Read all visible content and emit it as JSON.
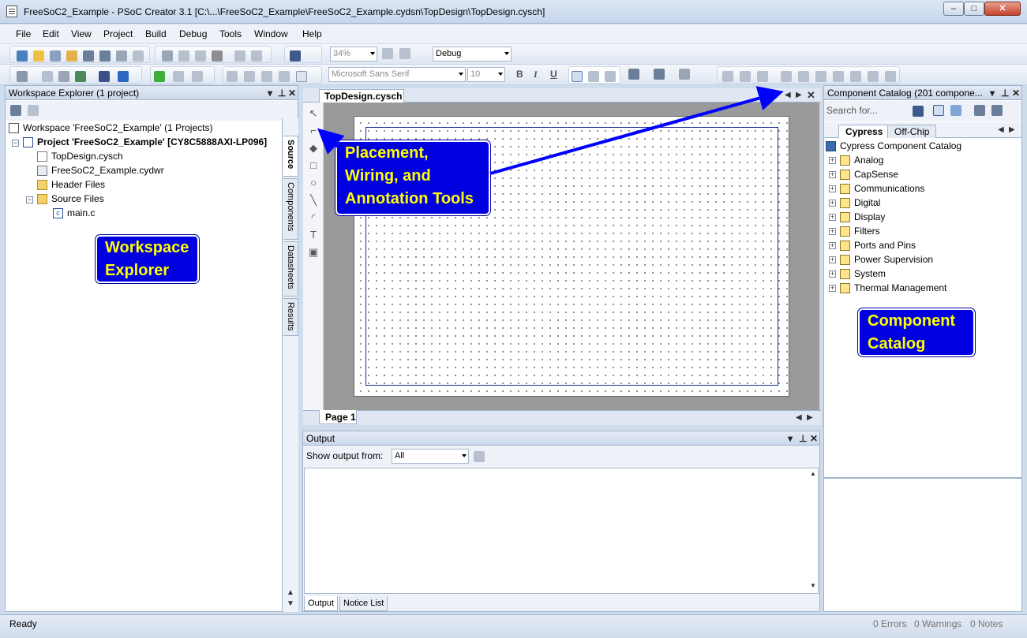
{
  "window": {
    "title": "FreeSoC2_Example - PSoC Creator 3.1  [C:\\...\\FreeSoC2_Example\\FreeSoC2_Example.cydsn\\TopDesign\\TopDesign.cysch]",
    "min": "–",
    "max": "□",
    "close": "✕"
  },
  "menu": [
    "File",
    "Edit",
    "View",
    "Project",
    "Build",
    "Debug",
    "Tools",
    "Window",
    "Help"
  ],
  "toolbar": {
    "zoom": "34%",
    "config": "Debug",
    "font": "Microsoft Sans Serif",
    "font_size": "10",
    "bold": "B",
    "italic": "I",
    "underline": "U"
  },
  "workspace": {
    "header": "Workspace Explorer (1 project)",
    "tree": [
      {
        "label": "Workspace 'FreeSoC2_Example' (1 Projects)",
        "icon": "workspace-icon"
      },
      {
        "label": "Project  'FreeSoC2_Example' [CY8C5888AXI-LP096]",
        "icon": "project-icon"
      },
      {
        "label": "TopDesign.cysch",
        "icon": "schematic-icon"
      },
      {
        "label": "FreeSoC2_Example.cydwr",
        "icon": "cydwr-icon"
      },
      {
        "label": "Header Files",
        "icon": "folder-icon"
      },
      {
        "label": "Source Files",
        "icon": "folder-icon"
      },
      {
        "label": "main.c",
        "icon": "c-file-icon"
      }
    ],
    "side_tabs": [
      "Source",
      "Components",
      "Datasheets",
      "Results"
    ]
  },
  "callouts": {
    "workspace": [
      "Workspace",
      "Explorer"
    ],
    "tools": [
      "Placement,",
      "Wiring, and",
      "Annotation Tools"
    ],
    "catalog": [
      "Component",
      "Catalog"
    ]
  },
  "design": {
    "tab": "TopDesign.cysch",
    "page_tab": "Page 1",
    "palette": [
      "select-tool-icon",
      "wire-tool-icon",
      "component-tool-icon",
      "rectangle-tool-icon",
      "ellipse-tool-icon",
      "line-tool-icon",
      "arc-tool-icon",
      "text-tool-icon",
      "image-tool-icon"
    ]
  },
  "output": {
    "header": "Output",
    "show_label": "Show output from:",
    "show_value": "All",
    "tabs": [
      "Output",
      "Notice List"
    ]
  },
  "catalog": {
    "header": "Component Catalog (201 compone...",
    "search_placeholder": "Search for...",
    "tabs": [
      "Cypress",
      "Off-Chip"
    ],
    "root": "Cypress Component Catalog",
    "items": [
      "Analog",
      "CapSense",
      "Communications",
      "Digital",
      "Display",
      "Filters",
      "Ports and Pins",
      "Power Supervision",
      "System",
      "Thermal Management"
    ]
  },
  "status": {
    "ready": "Ready",
    "errors": "0 Errors",
    "warnings": "0 Warnings",
    "notices": "0 Notes"
  },
  "colors": {
    "callout_bg": "#0000e0",
    "callout_text": "#ffff00",
    "arrow": "#0000ff"
  }
}
